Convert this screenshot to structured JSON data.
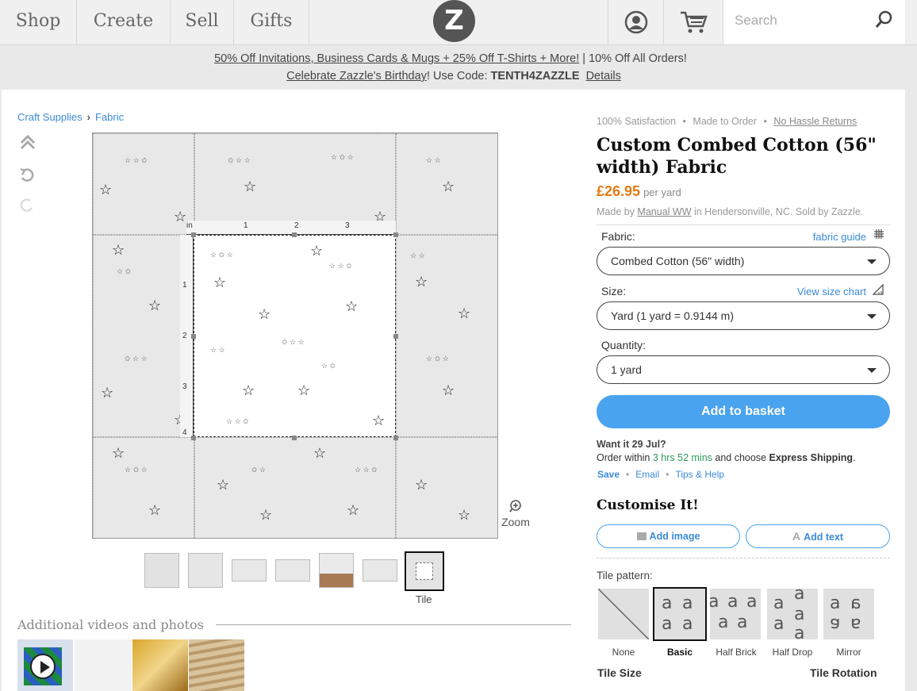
{
  "nav": {
    "items": [
      "Shop",
      "Create",
      "Sell",
      "Gifts"
    ],
    "logo": "Z",
    "search_placeholder": "Search"
  },
  "promo": {
    "line1_link": "50% Off Invitations, Business Cards & Mugs + 25% Off T-Shirts + More!",
    "line1_rest": " | 10% Off All Orders!",
    "line2_link": "Celebrate Zazzle's Birthday",
    "line2_mid": "!  Use Code: ",
    "code": "TENTH4ZAZZLE",
    "details": "Details"
  },
  "breadcrumb": [
    "Craft Supplies",
    "Fabric"
  ],
  "editor": {
    "ruler_unit": "in",
    "ruler_top": [
      "1",
      "2",
      "3"
    ],
    "ruler_left": [
      "1",
      "2",
      "3",
      "4"
    ],
    "zoom_label": "Zoom"
  },
  "thumbs": {
    "selected_label": "Tile"
  },
  "additional": {
    "heading": "Additional videos and photos"
  },
  "product": {
    "meta_1": "100% Satisfaction",
    "meta_2": "Made to Order",
    "meta_3": "No Hassle Returns",
    "title": "Custom Combed Cotton (56\" width) Fabric",
    "price": "£26.95",
    "price_unit": "per yard",
    "made_by_prefix": "Made by ",
    "made_by_name": "Manual WW",
    "made_by_suffix": " in Hendersonville, NC. Sold by Zazzle.",
    "fabric_label": "Fabric:",
    "fabric_link": "fabric guide",
    "fabric_value": "Combed Cotton (56\" width)",
    "size_label": "Size:",
    "size_link": "View size chart",
    "size_value": "Yard (1 yard = 0.9144 m)",
    "qty_label": "Quantity:",
    "qty_value": "1 yard",
    "add_button": "Add to basket",
    "want_prefix": "Want it 29 Jul?",
    "order_prefix": "Order within ",
    "order_time": "3 hrs 52 mins",
    "order_mid": " and choose ",
    "order_ship": "Express Shipping",
    "order_end": ".",
    "link_save": "Save",
    "link_email": "Email",
    "link_tips": "Tips & Help",
    "customise": "Customise It!",
    "add_image": "Add image",
    "add_text": "Add text",
    "tile_pattern_label": "Tile pattern:",
    "tile_options": [
      "None",
      "Basic",
      "Half Brick",
      "Half Drop",
      "Mirror"
    ],
    "tile_selected": "Basic",
    "tile_size_label": "Tile Size",
    "tile_rotation_label": "Tile Rotation"
  },
  "colors": {
    "accent": "#4aa3ef",
    "price": "#e37b17",
    "link": "#3b8bd6",
    "green": "#2a9a5a"
  }
}
